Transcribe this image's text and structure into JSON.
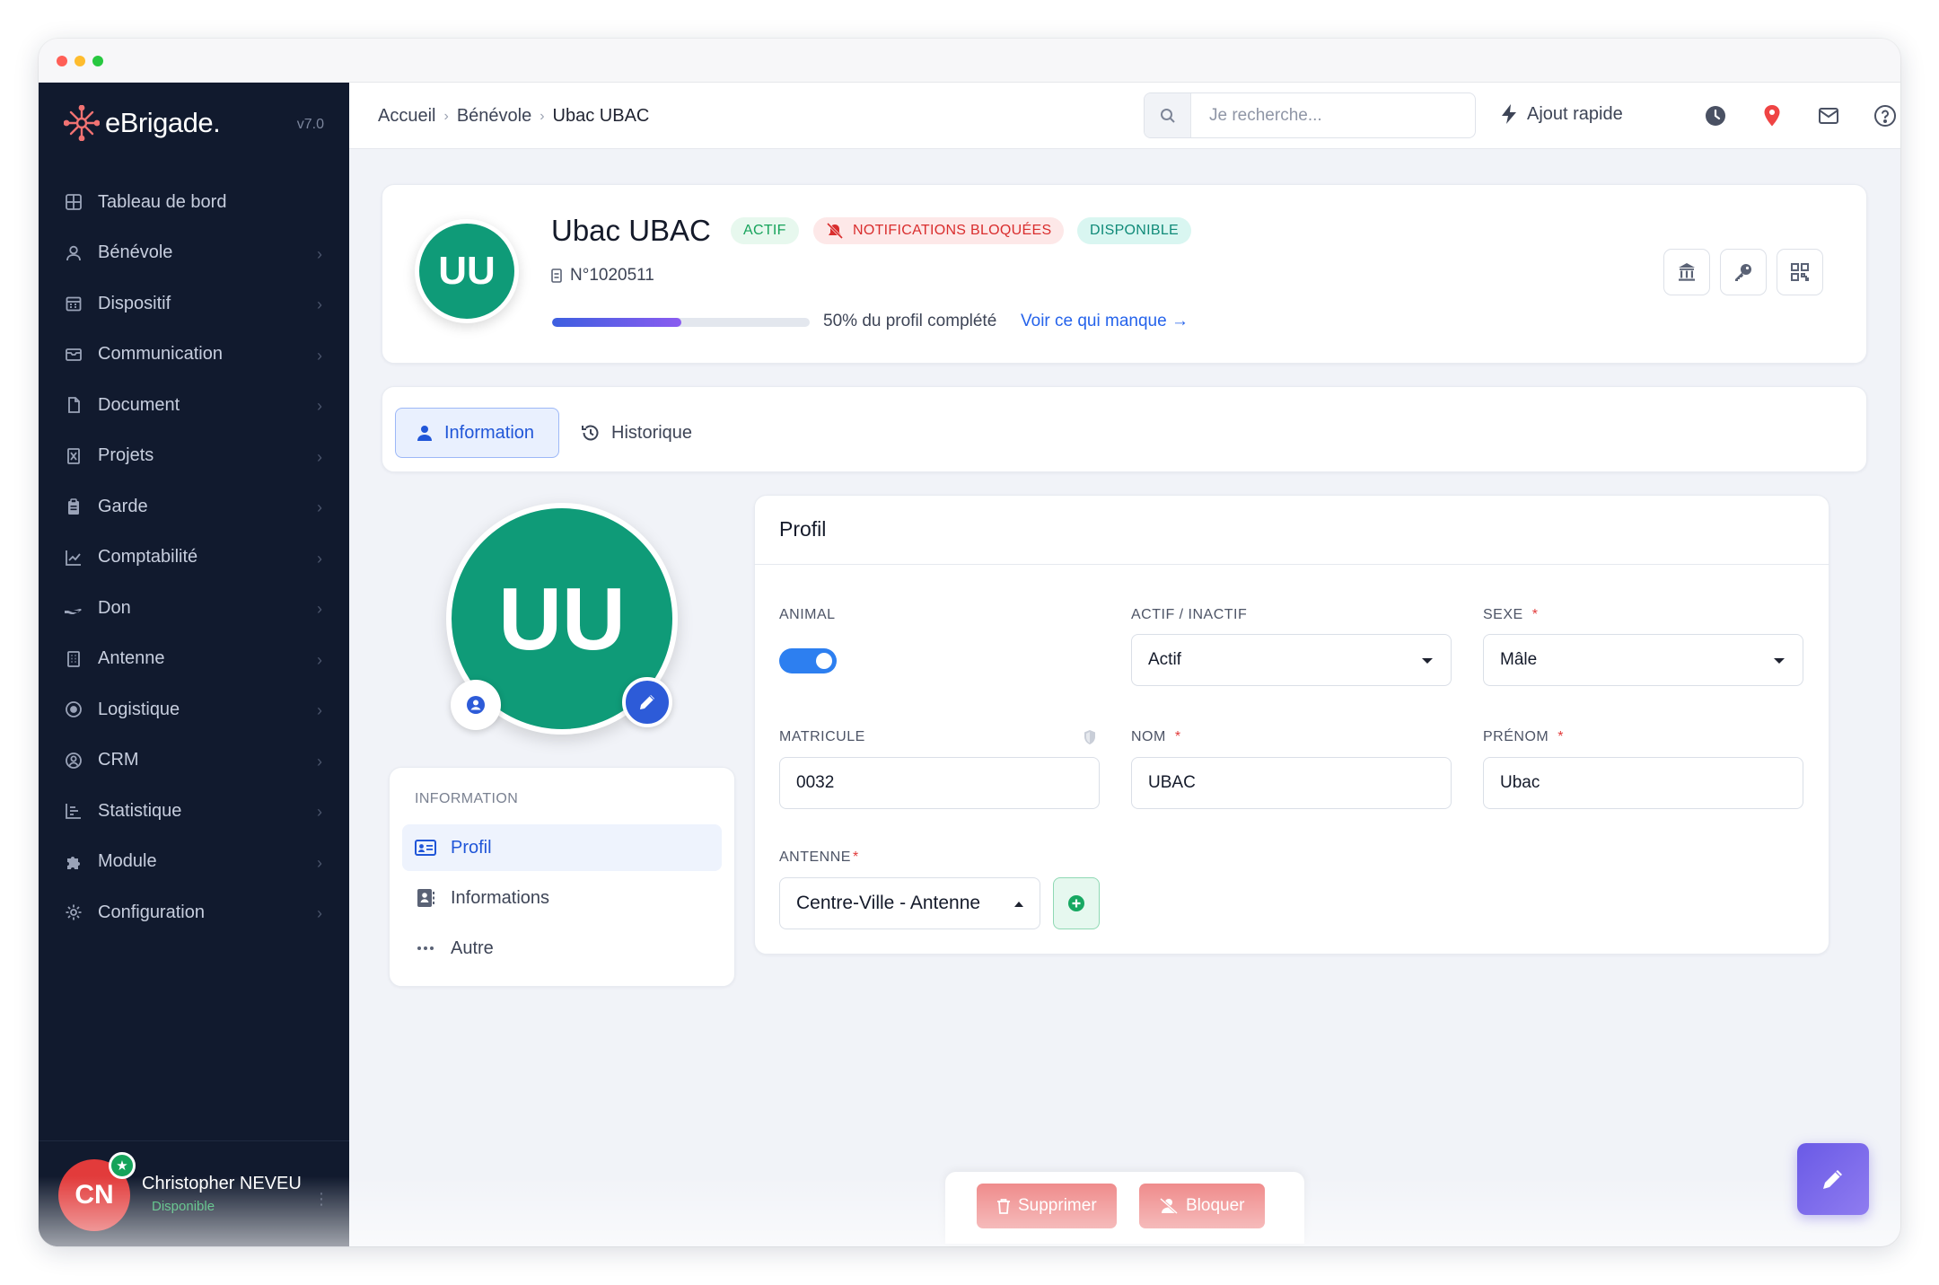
{
  "app": {
    "name_prefix": "e",
    "name_main": "Brigade.",
    "version": "v7.0"
  },
  "sidebar": {
    "items": [
      {
        "label": "Tableau de bord",
        "icon": "dashboard-icon"
      },
      {
        "label": "Bénévole",
        "icon": "user-icon"
      },
      {
        "label": "Dispositif",
        "icon": "calendar-icon"
      },
      {
        "label": "Communication",
        "icon": "mail-icon"
      },
      {
        "label": "Document",
        "icon": "file-icon"
      },
      {
        "label": "Projets",
        "icon": "project-icon"
      },
      {
        "label": "Garde",
        "icon": "clipboard-icon"
      },
      {
        "label": "Comptabilité",
        "icon": "chart-line-icon"
      },
      {
        "label": "Don",
        "icon": "hand-icon"
      },
      {
        "label": "Antenne",
        "icon": "building-icon"
      },
      {
        "label": "Logistique",
        "icon": "target-icon"
      },
      {
        "label": "CRM",
        "icon": "contact-icon"
      },
      {
        "label": "Statistique",
        "icon": "stats-icon"
      },
      {
        "label": "Module",
        "icon": "puzzle-icon"
      },
      {
        "label": "Configuration",
        "icon": "gear-icon"
      }
    ],
    "user": {
      "initials": "CN",
      "name": "Christopher NEVEU",
      "status": "Disponible"
    }
  },
  "topbar": {
    "breadcrumb": [
      "Accueil",
      "Bénévole",
      "Ubac UBAC"
    ],
    "search_placeholder": "Je recherche...",
    "quick_add": "Ajout rapide"
  },
  "profile": {
    "initials": "UU",
    "name": "Ubac UBAC",
    "badges": {
      "actif": "ACTIF",
      "notifications": "NOTIFICATIONS BLOQUÉES",
      "disponible": "DISPONIBLE"
    },
    "id_number": "N°1020511",
    "progress": 0.5,
    "progress_pct": "50%",
    "progress_text": "du profil complété",
    "progress_link": "Voir ce qui manque →"
  },
  "tabs": {
    "information": "Information",
    "historique": "Historique"
  },
  "side_menu": {
    "heading": "INFORMATION",
    "items": [
      "Profil",
      "Informations",
      "Autre"
    ]
  },
  "form": {
    "title": "Profil",
    "animal_label": "ANIMAL",
    "animal_on": true,
    "actif_label": "ACTIF / INACTIF",
    "actif_value": "Actif",
    "sexe_label": "SEXE",
    "sexe_value": "Mâle",
    "matricule_label": "MATRICULE",
    "matricule_value": "0032",
    "nom_label": "NOM",
    "nom_value": "UBAC",
    "prenom_label": "PRÉNOM",
    "prenom_value": "Ubac",
    "antenne_label": "ANTENNE",
    "antenne_value": "Centre-Ville - Antenne",
    "required_mark": "*"
  },
  "actions": {
    "supprimer": "Supprimer",
    "bloquer": "Bloquer"
  }
}
